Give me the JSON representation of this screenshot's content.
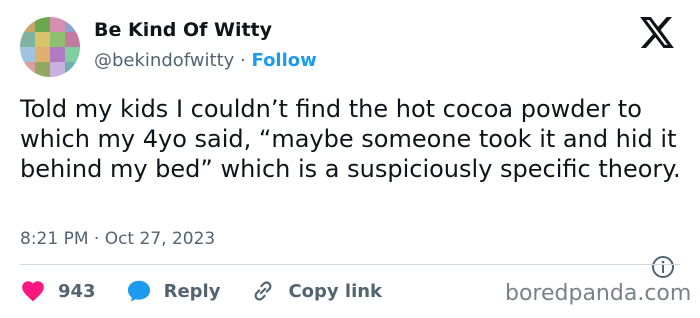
{
  "author": {
    "name": "Be Kind Of Witty",
    "handle": "@bekindofwitty",
    "separator": "·",
    "follow_label": "Follow"
  },
  "tweet": {
    "text": "Told my kids I couldn’t find the hot cocoa powder to which my 4yo said, “maybe someone took it and hid it behind my bed” which is a suspiciously specific theory.",
    "timestamp": "8:21 PM · Oct 27, 2023"
  },
  "actions": {
    "like_count": "943",
    "reply_label": "Reply",
    "copy_label": "Copy link"
  },
  "watermark": "boredpanda.com",
  "icons": {
    "brand": "x-logo-icon",
    "info": "info-icon",
    "like": "heart-icon",
    "reply": "speech-bubble-icon",
    "copy": "link-icon"
  },
  "colors": {
    "text": "#0f1419",
    "secondary": "#536471",
    "accent": "#1d9bf0",
    "like": "#f91880",
    "divider": "#cfd9de"
  }
}
